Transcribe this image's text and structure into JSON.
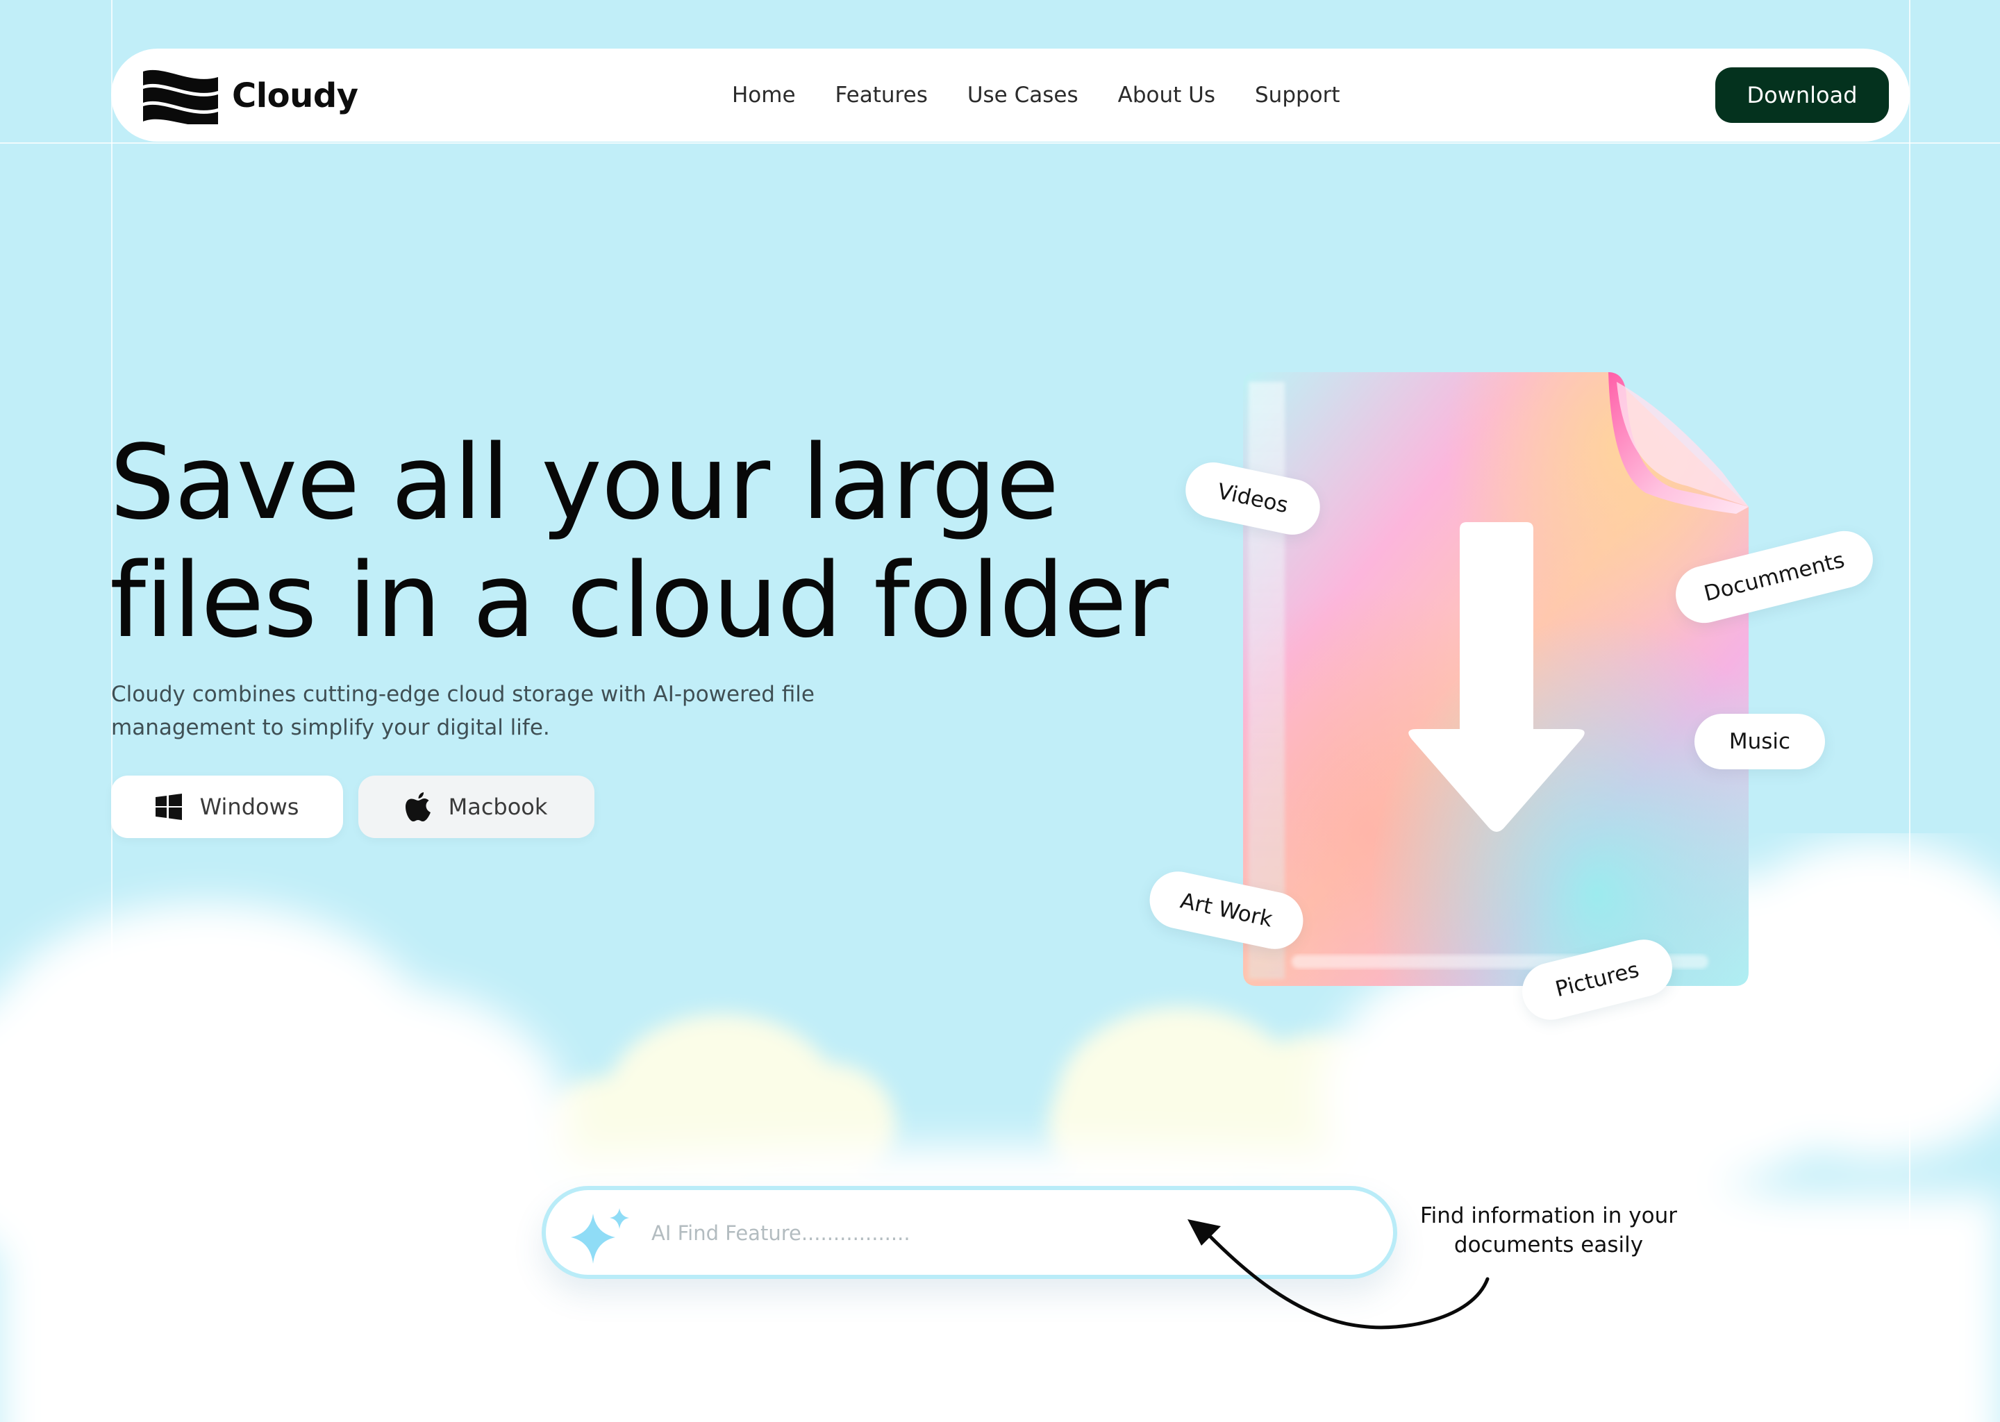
{
  "brand": {
    "name": "Cloudy"
  },
  "nav": {
    "items": [
      {
        "label": "Home"
      },
      {
        "label": "Features"
      },
      {
        "label": "Use Cases"
      },
      {
        "label": "About Us"
      },
      {
        "label": "Support"
      }
    ],
    "download_label": "Download"
  },
  "hero": {
    "title_line1": "Save all your large",
    "title_line2": "files in a cloud folder",
    "subtitle": "Cloudy combines cutting-edge cloud storage with AI-powered file management to simplify your digital life.",
    "buttons": {
      "windows": "Windows",
      "mac": "Macbook"
    }
  },
  "tags": [
    "Videos",
    "Documments",
    "Music",
    "Art Work",
    "Pictures"
  ],
  "search": {
    "placeholder": "AI Find Feature.................",
    "annotation": "Find information in your documents easily"
  },
  "colors": {
    "background": "#c1eef8",
    "primary": "#04321e",
    "search_border": "#b9ecf8"
  }
}
